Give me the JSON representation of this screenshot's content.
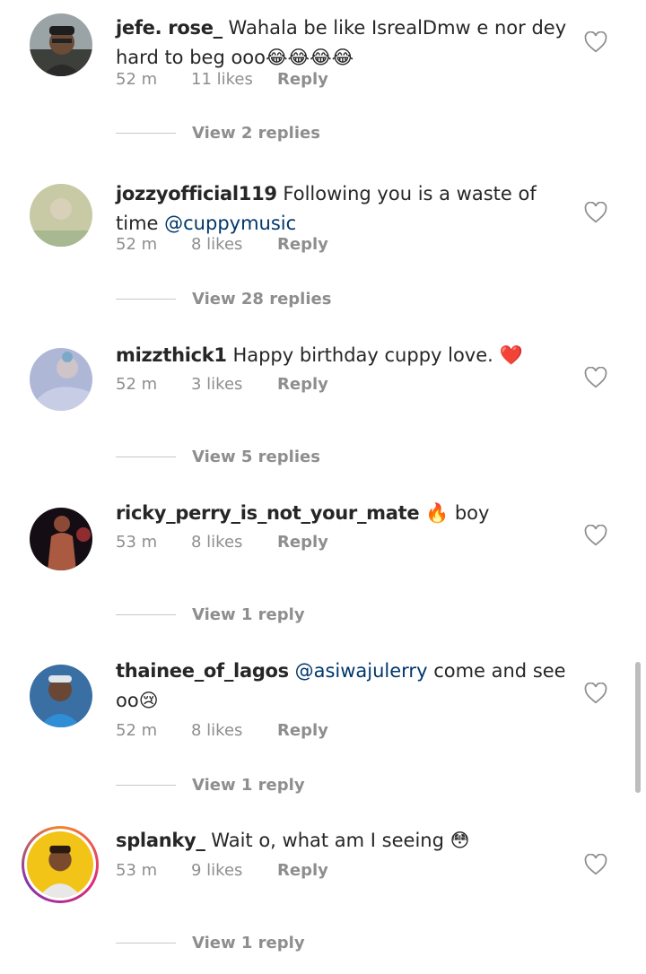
{
  "comments": [
    {
      "username": "jefe. rose_",
      "text": "Wahala be like IsrealDmw e nor dey hard to beg ooo😂😂😂😂",
      "mention": "",
      "time": "52 m",
      "likes": "11 likes",
      "reply_label": "Reply",
      "view_replies": "View 2 replies"
    },
    {
      "username": "jozzyofficial119",
      "text": "Following you is a waste of time",
      "mention": "@cuppymusic",
      "time": "52 m",
      "likes": "8 likes",
      "reply_label": "Reply",
      "view_replies": "View 28 replies"
    },
    {
      "username": "mizzthick1",
      "text": "Happy birthday cuppy love. ❤️",
      "mention": "",
      "time": "52 m",
      "likes": "3 likes",
      "reply_label": "Reply",
      "view_replies": "View 5 replies"
    },
    {
      "username": "ricky_perry_is_not_your_mate",
      "text": "🔥 boy",
      "mention": "",
      "time": "53 m",
      "likes": "8 likes",
      "reply_label": "Reply",
      "view_replies": "View 1 reply"
    },
    {
      "username": "thainee_of_lagos",
      "mention": "@asiwajulerry",
      "text": "come and see oo😢",
      "time": "52 m",
      "likes": "8 likes",
      "reply_label": "Reply",
      "view_replies": "View 1 reply"
    },
    {
      "username": "splanky_",
      "text": "Wait o,  what am I seeing 😳",
      "mention": "",
      "time": "53 m",
      "likes": "9 likes",
      "reply_label": "Reply",
      "view_replies": "View 1 reply"
    }
  ],
  "icons": {
    "like": "heart-outline-icon"
  },
  "colors": {
    "username": "#262626",
    "meta": "#8e8e8e",
    "mention": "#00376b",
    "story_ring": "#dd2a7b"
  }
}
